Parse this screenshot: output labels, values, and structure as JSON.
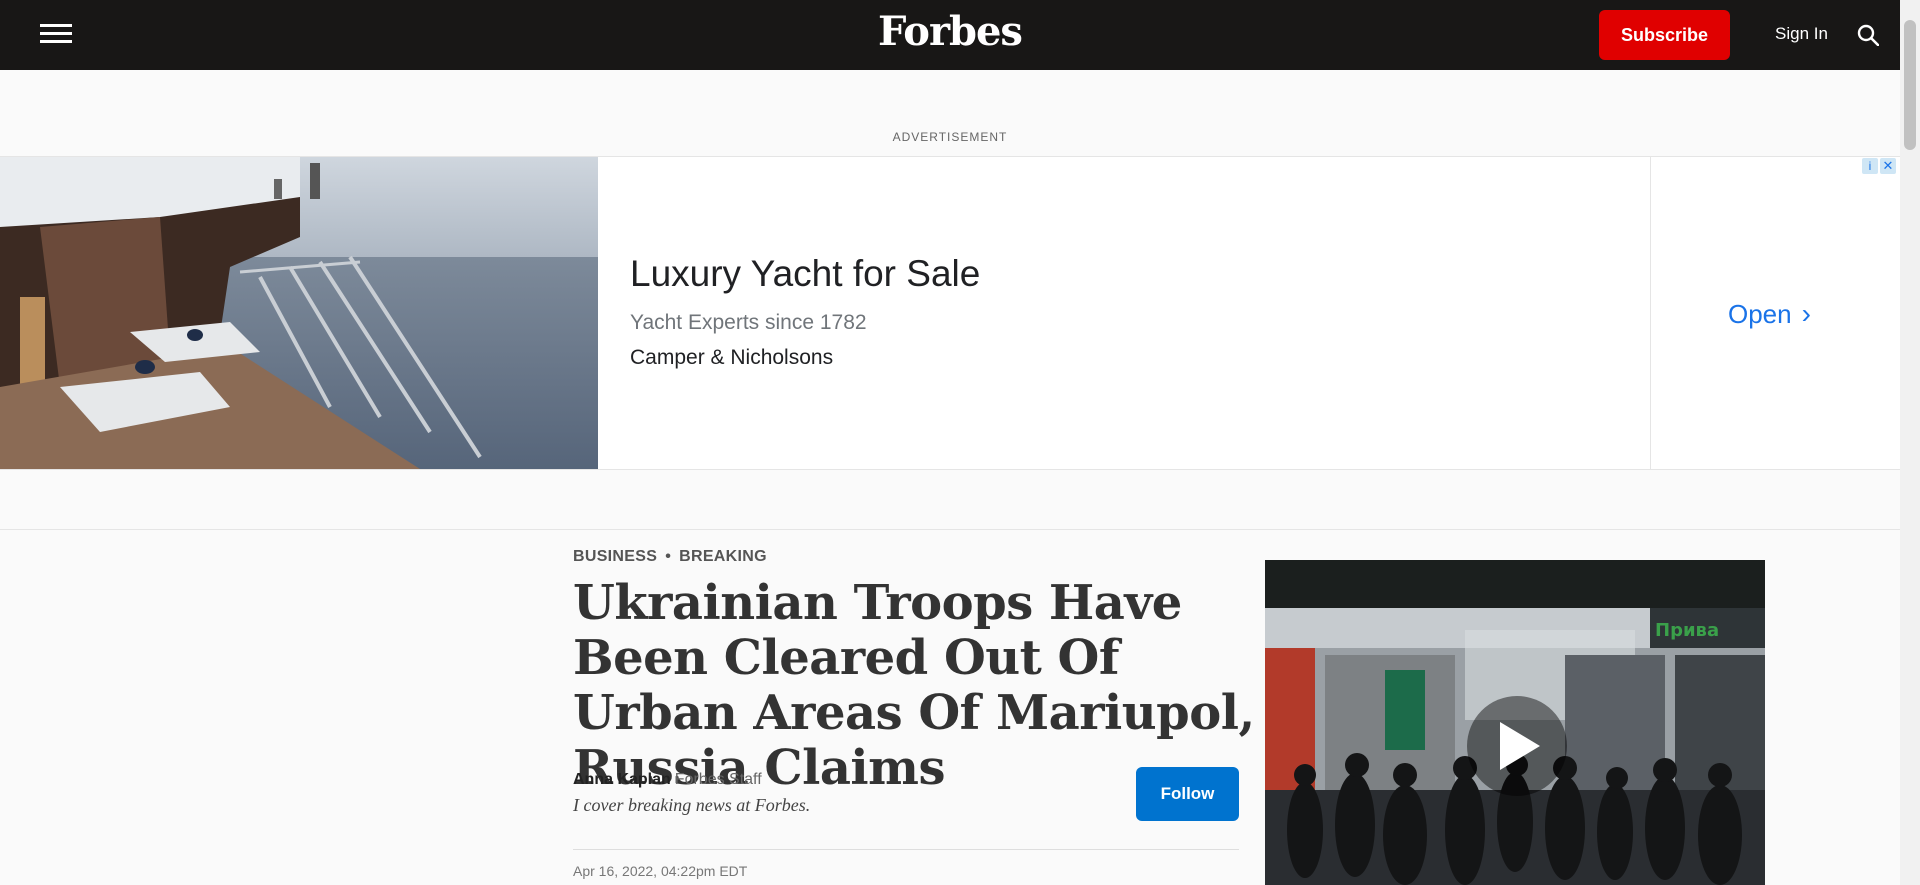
{
  "header": {
    "logo": "Forbes",
    "subscribe_label": "Subscribe",
    "signin_label": "Sign In",
    "menu_icon": "hamburger-menu-icon",
    "search_icon": "search-icon"
  },
  "advertisement": {
    "label": "ADVERTISEMENT",
    "title": "Luxury Yacht for Sale",
    "subtitle": "Yacht Experts since 1782",
    "brand": "Camper & Nicholsons",
    "open_label": "Open",
    "info_icon": "ad-info-icon",
    "close_icon": "ad-close-icon"
  },
  "article": {
    "category": "BUSINESS",
    "section": "BREAKING",
    "headline": "Ukrainian Troops Have Been Cleared Out Of Urban Areas Of Mariupol, Russia Claims",
    "author_name": "Anna Kaplan",
    "author_role": "Forbes Staff",
    "author_bio": "I cover breaking news at Forbes.",
    "follow_label": "Follow",
    "date": "Apr 16, 2022, 04:22pm EDT"
  },
  "video": {
    "play_icon": "play-icon",
    "sign_text": "Прива"
  },
  "colors": {
    "header_bg": "#181716",
    "subscribe_bg": "#e00000",
    "follow_bg": "#0073cf",
    "ad_link": "#1a73e8"
  }
}
